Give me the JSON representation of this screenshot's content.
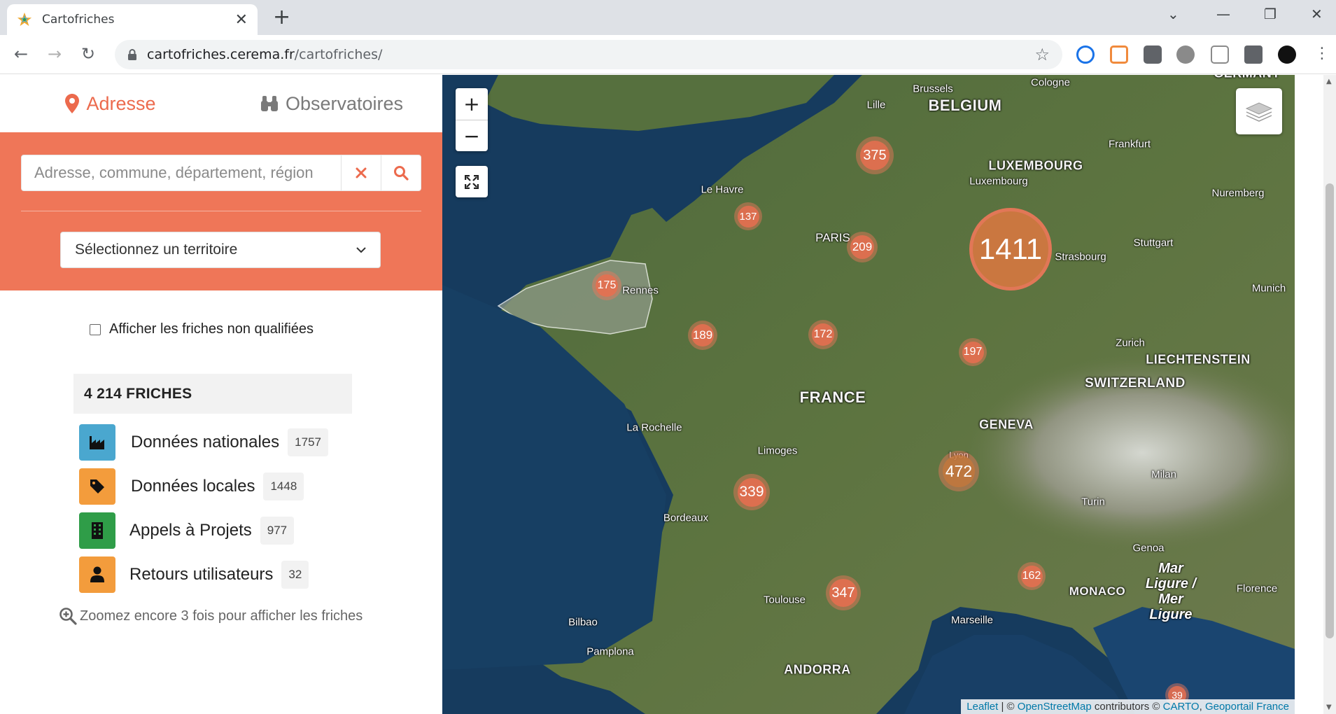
{
  "browser": {
    "tab_title": "Cartofriches",
    "url_host": "cartofriches.cerema.fr",
    "url_path": "/cartofriches/"
  },
  "panel": {
    "tab_address": "Adresse",
    "tab_observatories": "Observatoires",
    "search_placeholder": "Adresse, commune, département, région",
    "territory_select": "Sélectionnez un territoire",
    "checkbox_label": "Afficher les friches non qualifiées",
    "total": "4 214 FRICHES",
    "categories": [
      {
        "label": "Données nationales",
        "count": "1757",
        "color": "#4aa7cf",
        "icon": "factory-icon"
      },
      {
        "label": "Données locales",
        "count": "1448",
        "color": "#f39c3c",
        "icon": "tag-icon"
      },
      {
        "label": "Appels à Projets",
        "count": "977",
        "color": "#2f9d48",
        "icon": "building-icon"
      },
      {
        "label": "Retours utilisateurs",
        "count": "32",
        "color": "#f39c3c",
        "icon": "user-icon"
      }
    ],
    "zoom_hint": "Zoomez encore 3 fois pour afficher les friches"
  },
  "map": {
    "labels": {
      "brussels": "Brussels",
      "cologne": "Cologne",
      "lille": "Lille",
      "belgium": "BELGIUM",
      "frankfurt": "Frankfurt",
      "luxembourg_country": "LUXEMBOURG",
      "luxembourg_city": "Luxembourg",
      "nuremberg": "Nuremberg",
      "le_havre": "Le Havre",
      "paris": "PARIS",
      "stuttgart": "Stuttgart",
      "strasbourg": "Strasbourg",
      "munich": "Munich",
      "rennes": "Rennes",
      "zurich": "Zurich",
      "liechtenstein": "LIECHTENSTEIN",
      "switzerland": "SWITZERLAND",
      "france": "FRANCE",
      "la_rochelle": "La Rochelle",
      "geneva": "GENEVA",
      "limoges": "Limoges",
      "lyon": "Lyon",
      "milan": "Milan",
      "bordeaux": "Bordeaux",
      "turin": "Turin",
      "genoa": "Genoa",
      "monaco": "MONACO",
      "florence": "Florence",
      "toulouse": "Toulouse",
      "bilbao": "Bilbao",
      "marseille": "Marseille",
      "pamplona": "Pamplona",
      "andorra": "ANDORRA",
      "sea_line1": "Mar",
      "sea_line2": "Ligure /",
      "sea_line3": "Mer",
      "sea_line4": "Ligure",
      "germany": "GERMANY"
    },
    "clusters": {
      "c375": "375",
      "c137": "137",
      "c209": "209",
      "c1411": "1411",
      "c175": "175",
      "c189": "189",
      "c172": "172",
      "c197": "197",
      "c472": "472",
      "c339": "339",
      "c162": "162",
      "c347": "347",
      "c39": "39"
    },
    "attribution": {
      "leaflet": "Leaflet",
      "sep1": " | © ",
      "osm": "OpenStreetMap",
      "contrib": " contributors © ",
      "carto": "CARTO",
      "comma": ", ",
      "geoportail": "Geoportail France"
    }
  }
}
